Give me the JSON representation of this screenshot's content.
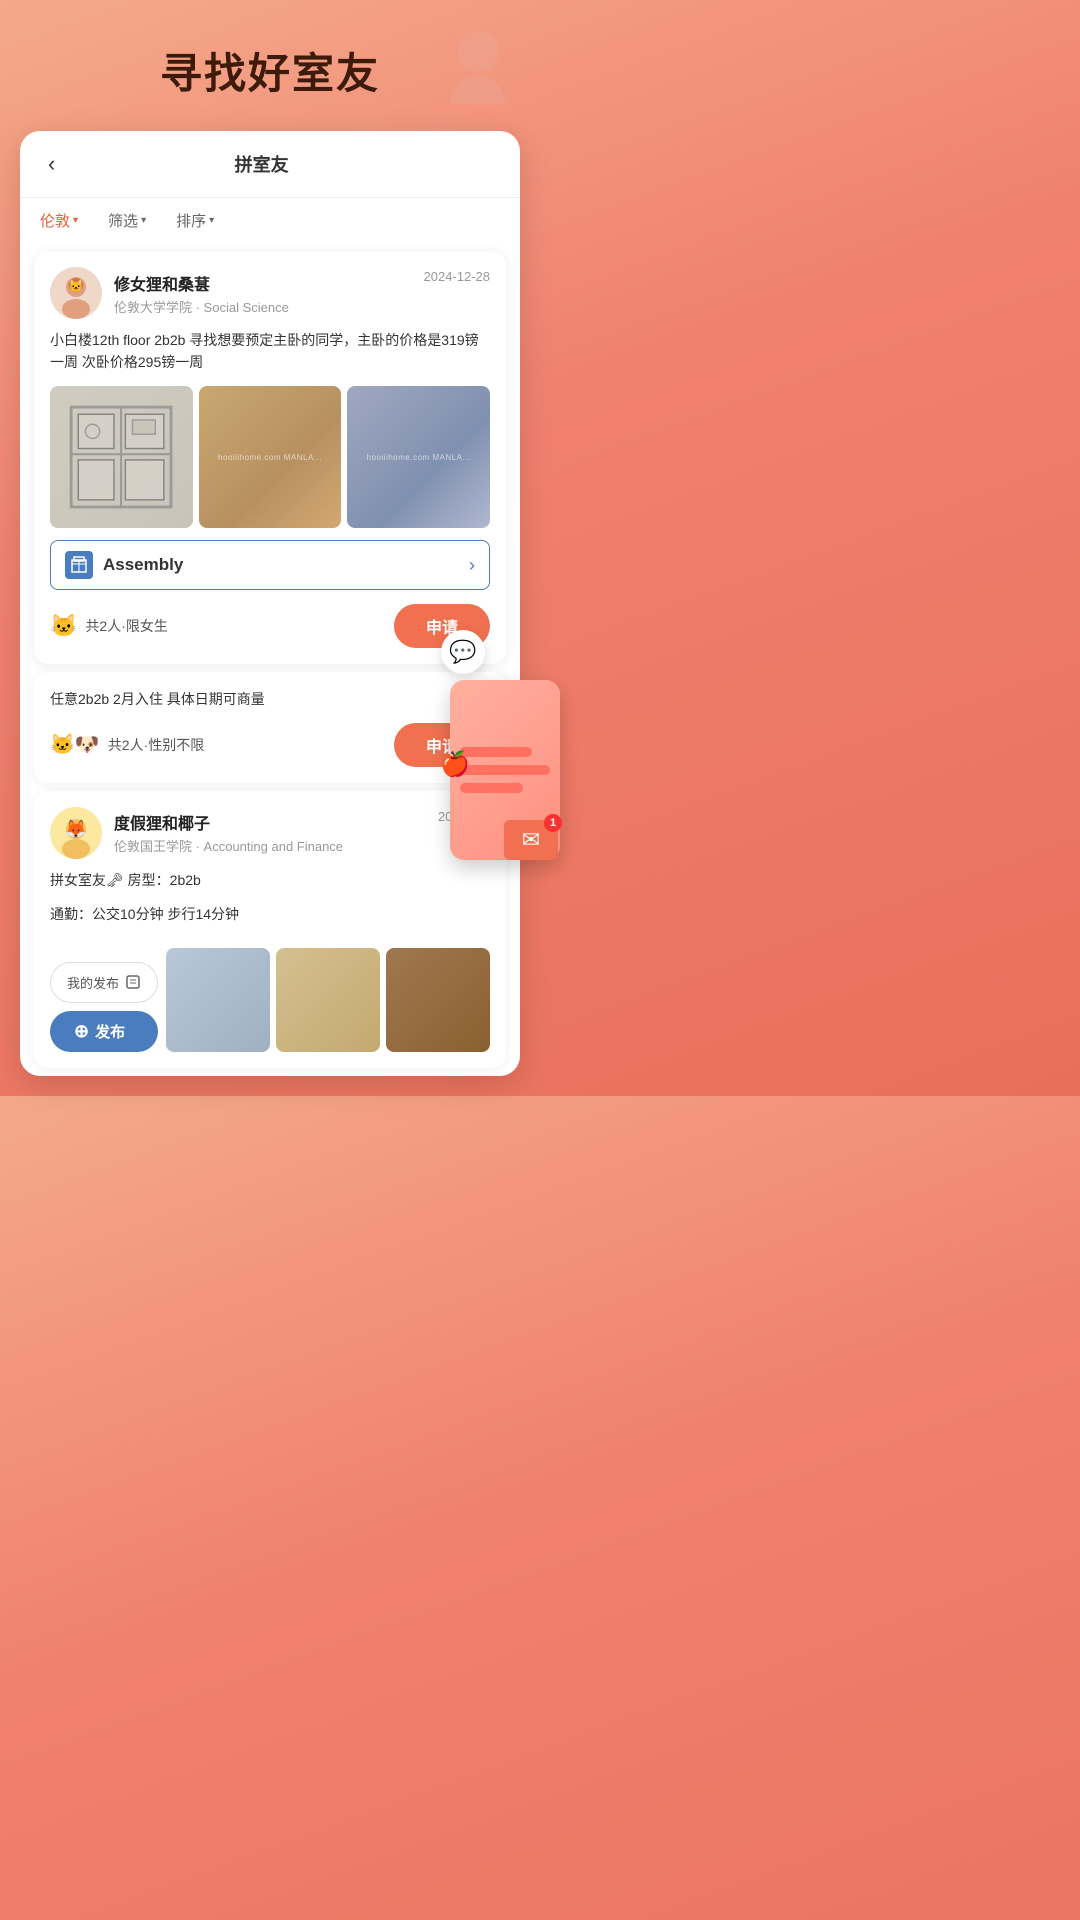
{
  "page": {
    "title": "寻找好室友",
    "background_gradient": "#f4a98a"
  },
  "navbar": {
    "back_label": "‹",
    "title": "拼室友"
  },
  "filters": {
    "location": {
      "label": "伦敦",
      "has_arrow": true
    },
    "filter": {
      "label": "筛选",
      "has_arrow": true
    },
    "sort": {
      "label": "排序",
      "has_arrow": true
    }
  },
  "listing1": {
    "user": {
      "name": "修女狸和桑葚",
      "avatar_emoji": "🐱",
      "school": "伦敦大学学院 · Social Science"
    },
    "date": "2024-12-28",
    "description": "小白楼12th floor 2b2b  寻找想要预定主卧的同学，主卧的价格是319镑一周 次卧价格295镑一周",
    "building": {
      "icon": "🏢",
      "name": "Assembly",
      "has_arrow": true
    },
    "people_info": "共2人·限女生",
    "apply_btn": "申请"
  },
  "listing2": {
    "description": "任意2b2b 2月入住 具体日期可商量",
    "people_info": "共2人·性别不限",
    "apply_btn": "申请"
  },
  "listing3": {
    "user": {
      "name": "度假狸和椰子",
      "avatar_emoji": "🦊",
      "school": "伦敦国王学院 · Accounting and Finance"
    },
    "date": "2024-09-",
    "description_line1": "拼女室友🗝 房型：2b2b",
    "description_line2": "通勤：公交10分钟 步行14分钟"
  },
  "bottom_actions": {
    "my_publish": "我的发布",
    "publish": "+ 发布"
  },
  "icons": {
    "back": "‹",
    "arrow_down": "▾",
    "chevron_right": "›",
    "plus": "+",
    "building": "🏢",
    "mail": "✉",
    "chat": "💬",
    "publish_icon": "📋"
  }
}
